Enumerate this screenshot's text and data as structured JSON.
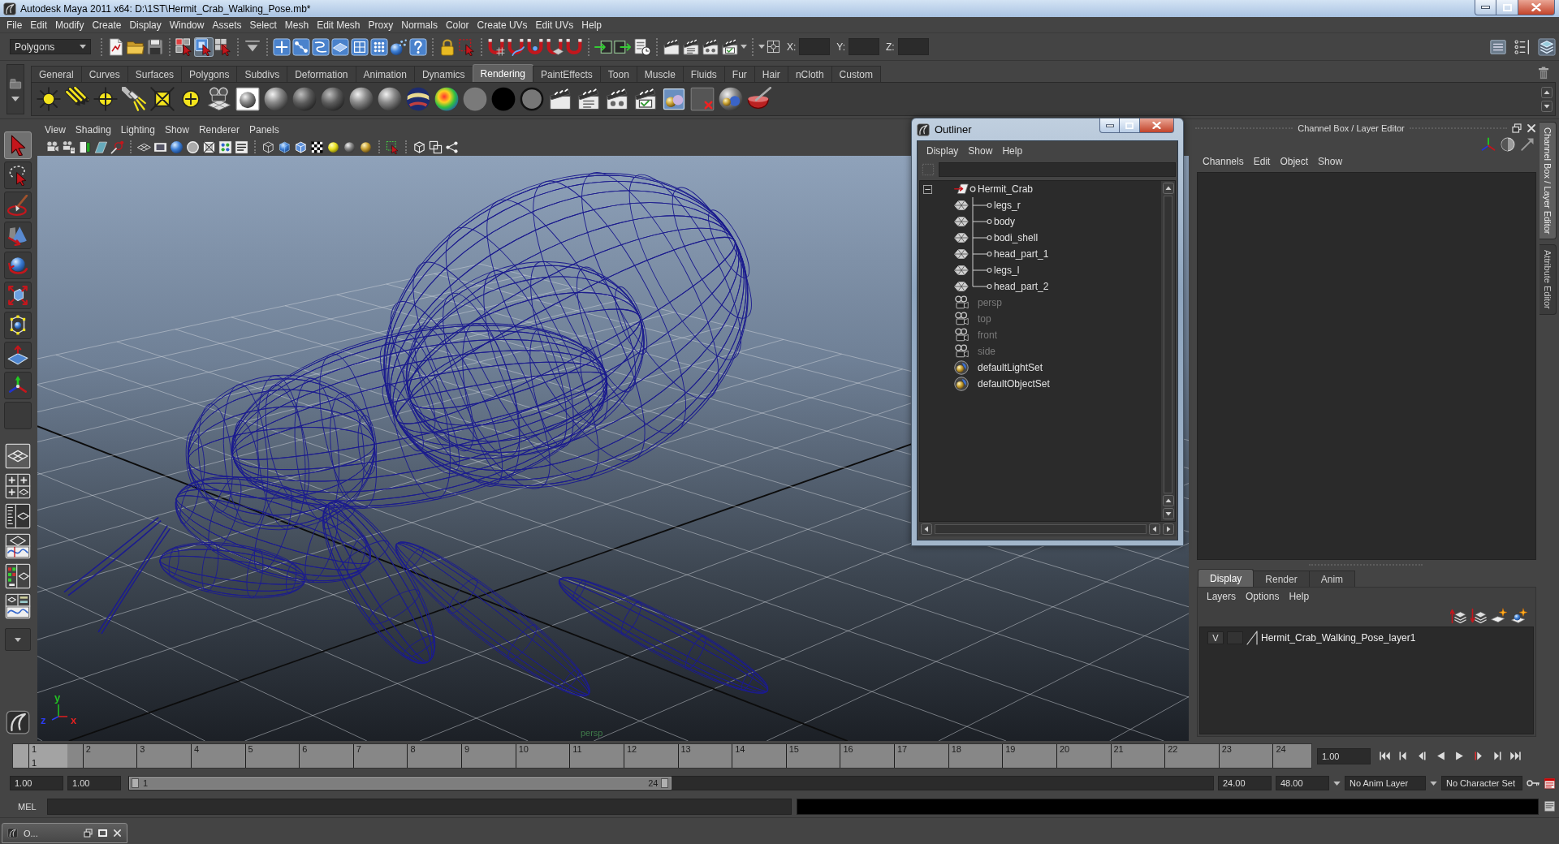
{
  "window": {
    "title": "Autodesk Maya 2011 x64: D:\\1ST\\Hermit_Crab_Walking_Pose.mb*"
  },
  "menu_bar": [
    "File",
    "Edit",
    "Modify",
    "Create",
    "Display",
    "Window",
    "Assets",
    "Select",
    "Mesh",
    "Edit Mesh",
    "Proxy",
    "Normals",
    "Color",
    "Create UVs",
    "Edit UVs",
    "Help"
  ],
  "status_line": {
    "menu_set": "Polygons",
    "selection_modes": [
      {
        "selected": false
      },
      {
        "selected": true
      },
      {
        "selected": false
      }
    ],
    "coordinates": [
      {
        "label": "X:"
      },
      {
        "label": "Y:"
      },
      {
        "label": "Z:"
      }
    ]
  },
  "shelf": {
    "tabs": [
      {
        "label": "General",
        "selected": false
      },
      {
        "label": "Curves",
        "selected": false
      },
      {
        "label": "Surfaces",
        "selected": false
      },
      {
        "label": "Polygons",
        "selected": false
      },
      {
        "label": "Subdivs",
        "selected": false
      },
      {
        "label": "Deformation",
        "selected": false
      },
      {
        "label": "Animation",
        "selected": false
      },
      {
        "label": "Dynamics",
        "selected": false
      },
      {
        "label": "Rendering",
        "selected": true
      },
      {
        "label": "PaintEffects",
        "selected": false
      },
      {
        "label": "Toon",
        "selected": false
      },
      {
        "label": "Muscle",
        "selected": false
      },
      {
        "label": "Fluids",
        "selected": false
      },
      {
        "label": "Fur",
        "selected": false
      },
      {
        "label": "Hair",
        "selected": false
      },
      {
        "label": "nCloth",
        "selected": false
      },
      {
        "label": "Custom",
        "selected": false
      }
    ]
  },
  "toolbox": {
    "tools": [
      {
        "selected": true
      },
      {
        "selected": false
      },
      {
        "selected": false
      },
      {
        "selected": false
      },
      {
        "selected": false
      },
      {
        "selected": false
      },
      {
        "selected": false
      },
      {
        "selected": false
      },
      {
        "selected": false
      }
    ]
  },
  "viewport": {
    "menu": [
      "View",
      "Shading",
      "Lighting",
      "Show",
      "Renderer",
      "Panels"
    ],
    "camera": "persp",
    "axes": [
      {
        "label": "y",
        "color": "#22c322"
      },
      {
        "label": "z",
        "color": "#2b3cf0"
      },
      {
        "label": "x",
        "color": "#e02020"
      }
    ]
  },
  "outliner": {
    "title": "Outliner",
    "menu": [
      "Display",
      "Show",
      "Help"
    ],
    "items": [
      {
        "label": "Hermit_Crab",
        "kind": "group",
        "expanded": true,
        "hidden": false,
        "children": [
          {
            "label": "legs_r",
            "kind": "mesh",
            "hidden": false
          },
          {
            "label": "body",
            "kind": "mesh",
            "hidden": false
          },
          {
            "label": "bodi_shell",
            "kind": "mesh",
            "hidden": false
          },
          {
            "label": "head_part_1",
            "kind": "mesh",
            "hidden": false
          },
          {
            "label": "legs_l",
            "kind": "mesh",
            "hidden": false
          },
          {
            "label": "head_part_2",
            "kind": "mesh",
            "hidden": false
          }
        ]
      },
      {
        "label": "persp",
        "kind": "camera",
        "hidden": true
      },
      {
        "label": "top",
        "kind": "camera",
        "hidden": true
      },
      {
        "label": "front",
        "kind": "camera",
        "hidden": true
      },
      {
        "label": "side",
        "kind": "camera",
        "hidden": true
      },
      {
        "label": "defaultLightSet",
        "kind": "set",
        "hidden": false
      },
      {
        "label": "defaultObjectSet",
        "kind": "set",
        "hidden": false
      }
    ]
  },
  "channel_box": {
    "title": "Channel Box / Layer Editor",
    "menu": [
      "Channels",
      "Edit",
      "Object",
      "Show"
    ]
  },
  "layer_editor": {
    "tabs": [
      {
        "label": "Display",
        "selected": true
      },
      {
        "label": "Render",
        "selected": false
      },
      {
        "label": "Anim",
        "selected": false
      }
    ],
    "menu": [
      "Layers",
      "Options",
      "Help"
    ],
    "layers": [
      {
        "visibility": "V",
        "name": "Hermit_Crab_Walking_Pose_layer1"
      }
    ]
  },
  "side_tabs": [
    {
      "label": "Channel Box / Layer Editor",
      "selected": true
    },
    {
      "label": "Attribute Editor",
      "selected": false
    }
  ],
  "time_slider": {
    "frames": [
      {
        "label": "1",
        "selected": true
      },
      {
        "label": "2",
        "selected": false
      },
      {
        "label": "3",
        "selected": false
      },
      {
        "label": "4",
        "selected": false
      },
      {
        "label": "5",
        "selected": false
      },
      {
        "label": "6",
        "selected": false
      },
      {
        "label": "7",
        "selected": false
      },
      {
        "label": "8",
        "selected": false
      },
      {
        "label": "9",
        "selected": false
      },
      {
        "label": "10",
        "selected": false
      },
      {
        "label": "11",
        "selected": false
      },
      {
        "label": "12",
        "selected": false
      },
      {
        "label": "13",
        "selected": false
      },
      {
        "label": "14",
        "selected": false
      },
      {
        "label": "15",
        "selected": false
      },
      {
        "label": "16",
        "selected": false
      },
      {
        "label": "17",
        "selected": false
      },
      {
        "label": "18",
        "selected": false
      },
      {
        "label": "19",
        "selected": false
      },
      {
        "label": "20",
        "selected": false
      },
      {
        "label": "21",
        "selected": false
      },
      {
        "label": "22",
        "selected": false
      },
      {
        "label": "23",
        "selected": false
      },
      {
        "label": "24",
        "selected": false
      }
    ],
    "current_frame": "1",
    "current_time": "1.00"
  },
  "range_slider": {
    "start_time": "1.00",
    "playback_start": "1.00",
    "range_start": "1",
    "range_end": "24",
    "level": 0.5,
    "playback_end": "24.00",
    "end_time": "48.00"
  },
  "playback_options": {
    "anim_layer": "No Anim Layer",
    "character_set": "No Character Set"
  },
  "command_line": {
    "language": "MEL"
  },
  "taskbar": {
    "windows": [
      {
        "title": "O..."
      }
    ]
  }
}
